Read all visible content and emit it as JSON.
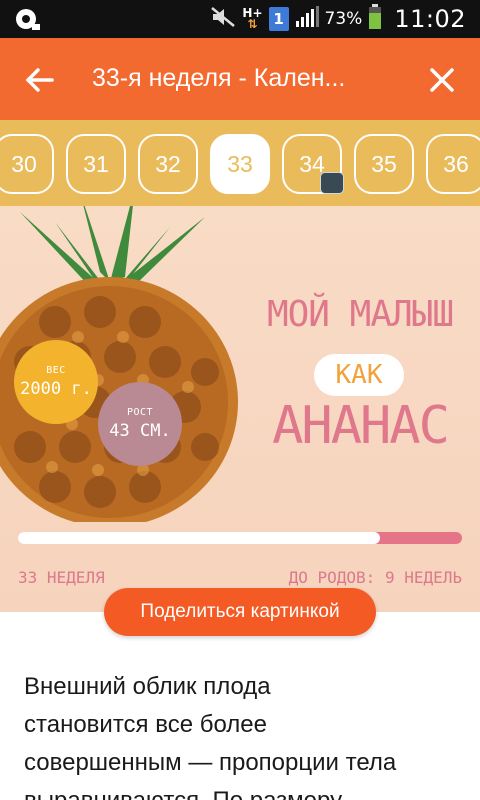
{
  "status_bar": {
    "network": "H+",
    "sim_slot": "1",
    "battery_percent": "73%",
    "time": "11:02",
    "icons": [
      "app-notification-icon",
      "mute-icon",
      "network-type-icon",
      "sim-icon",
      "signal-icon",
      "battery-icon"
    ]
  },
  "app_bar": {
    "title": "33-я неделя - Кален...",
    "back_icon": "arrow-left-icon",
    "close_icon": "close-icon"
  },
  "weeks": {
    "items": [
      "30",
      "31",
      "32",
      "33",
      "34",
      "35",
      "36"
    ],
    "selected": "33"
  },
  "hero": {
    "weight_label": "ВЕС",
    "weight_value": "2000 г.",
    "height_label": "РОСТ",
    "height_value": "43 СМ.",
    "headline_line1": "МОЙ МАЛЫШ",
    "headline_kak": "КАК",
    "headline_line2": "АНАНАС",
    "progress_fraction": 0.815,
    "week_label": "33 НЕДЕЛЯ",
    "remaining_label": "ДО РОДОВ: 9 НЕДЕЛЬ"
  },
  "share_button": {
    "label": "Поделиться картинкой"
  },
  "article": {
    "lines": [
      "Внешний облик плода",
      "становится все более",
      "совершенным — пропорции тела",
      "выравниваются. По размеру"
    ]
  },
  "colors": {
    "app_bar": "#f26a2f",
    "week_bar": "#e9bb5b",
    "share_button": "#f45a24",
    "hero_text": "#e0788c"
  }
}
